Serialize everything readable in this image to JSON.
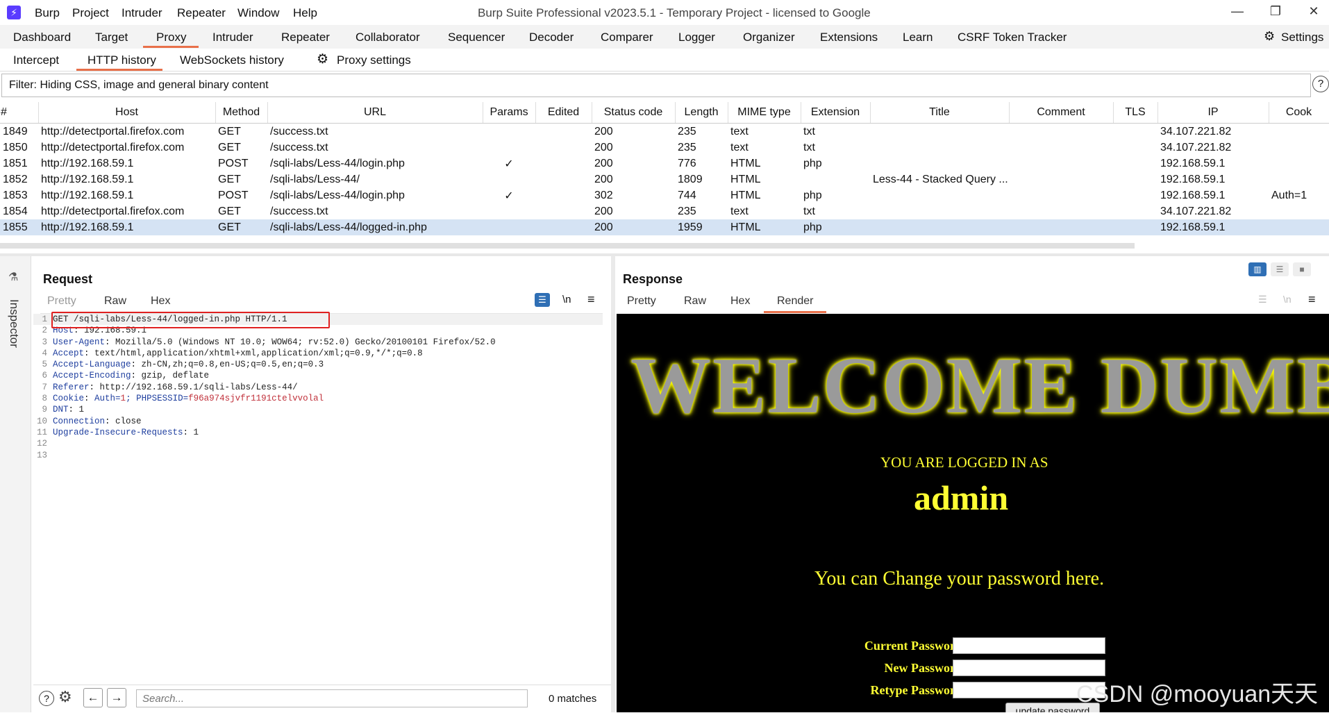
{
  "window": {
    "title": "Burp Suite Professional v2023.5.1 - Temporary Project - licensed to Google"
  },
  "menu": [
    "Burp",
    "Project",
    "Intruder",
    "Repeater",
    "Window",
    "Help"
  ],
  "tabs": [
    "Dashboard",
    "Target",
    "Proxy",
    "Intruder",
    "Repeater",
    "Collaborator",
    "Sequencer",
    "Decoder",
    "Comparer",
    "Logger",
    "Organizer",
    "Extensions",
    "Learn",
    "CSRF Token Tracker"
  ],
  "settings_label": "Settings",
  "subtabs": [
    "Intercept",
    "HTTP history",
    "WebSockets history"
  ],
  "proxy_settings": "Proxy settings",
  "filter": "Filter: Hiding CSS, image and general binary content",
  "table": {
    "headers": [
      "#",
      "Host",
      "Method",
      "URL",
      "Params",
      "Edited",
      "Status code",
      "Length",
      "MIME type",
      "Extension",
      "Title",
      "Comment",
      "TLS",
      "IP",
      "Cook"
    ],
    "rows": [
      [
        "1849",
        "http://detectportal.firefox.com",
        "GET",
        "/success.txt",
        "",
        "",
        "200",
        "235",
        "text",
        "txt",
        "",
        "",
        "",
        "34.107.221.82",
        ""
      ],
      [
        "1850",
        "http://detectportal.firefox.com",
        "GET",
        "/success.txt",
        "",
        "",
        "200",
        "235",
        "text",
        "txt",
        "",
        "",
        "",
        "34.107.221.82",
        ""
      ],
      [
        "1851",
        "http://192.168.59.1",
        "POST",
        "/sqli-labs/Less-44/login.php",
        "✓",
        "",
        "200",
        "776",
        "HTML",
        "php",
        "",
        "",
        "",
        "192.168.59.1",
        ""
      ],
      [
        "1852",
        "http://192.168.59.1",
        "GET",
        "/sqli-labs/Less-44/",
        "",
        "",
        "200",
        "1809",
        "HTML",
        "",
        "Less-44 - Stacked Query ...",
        "",
        "",
        "192.168.59.1",
        ""
      ],
      [
        "1853",
        "http://192.168.59.1",
        "POST",
        "/sqli-labs/Less-44/login.php",
        "✓",
        "",
        "302",
        "744",
        "HTML",
        "php",
        "",
        "",
        "",
        "192.168.59.1",
        "Auth=1"
      ],
      [
        "1854",
        "http://detectportal.firefox.com",
        "GET",
        "/success.txt",
        "",
        "",
        "200",
        "235",
        "text",
        "txt",
        "",
        "",
        "",
        "34.107.221.82",
        ""
      ],
      [
        "1855",
        "http://192.168.59.1",
        "GET",
        "/sqli-labs/Less-44/logged-in.php",
        "",
        "",
        "200",
        "1959",
        "HTML",
        "php",
        "",
        "",
        "",
        "192.168.59.1",
        ""
      ]
    ],
    "selected_index": 6
  },
  "inspector_label": "Inspector",
  "request": {
    "title": "Request",
    "tabs": [
      "Pretty",
      "Raw",
      "Hex"
    ],
    "lines": [
      {
        "k": "GET /sqli-labs/Less-44/logged-in.php HTTP/1.1",
        "v": ""
      },
      {
        "k": "Host",
        "v": "192.168.59.1"
      },
      {
        "k": "User-Agent",
        "v": "Mozilla/5.0 (Windows NT 10.0; WOW64; rv:52.0) Gecko/20100101 Firefox/52.0"
      },
      {
        "k": "Accept",
        "v": "text/html,application/xhtml+xml,application/xml;q=0.9,*/*;q=0.8"
      },
      {
        "k": "Accept-Language",
        "v": "zh-CN,zh;q=0.8,en-US;q=0.5,en;q=0.3"
      },
      {
        "k": "Accept-Encoding",
        "v": "gzip, deflate"
      },
      {
        "k": "Referer",
        "v": "http://192.168.59.1/sqli-labs/Less-44/"
      },
      {
        "k": "Cookie",
        "v": "Auth=1; PHPSESSID=f96a974sjvfr1191ctelvvolal"
      },
      {
        "k": "DNT",
        "v": "1"
      },
      {
        "k": "Connection",
        "v": "close"
      },
      {
        "k": "Upgrade-Insecure-Requests",
        "v": "1"
      },
      {
        "k": "",
        "v": ""
      },
      {
        "k": "",
        "v": ""
      }
    ],
    "search_placeholder": "Search...",
    "matches": "0 matches"
  },
  "response": {
    "title": "Response",
    "tabs": [
      "Pretty",
      "Raw",
      "Hex",
      "Render"
    ],
    "welcome": "WELCOME DUMB",
    "logged_as": "YOU ARE LOGGED IN AS",
    "user": "admin",
    "change": "You can Change your password here.",
    "current_pw": "Current Password:",
    "new_pw": "New Password:",
    "retype_pw": "Retype Password:",
    "update_btn": "update password"
  },
  "watermark": "CSDN @mooyuan天天"
}
